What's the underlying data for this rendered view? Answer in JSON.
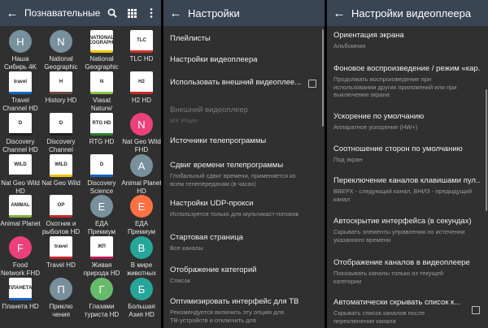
{
  "panel1": {
    "title": "Познавательные",
    "channels": [
      {
        "logo": "Н",
        "logo_type": "circle",
        "color": "#78909c",
        "name1": "Наша",
        "name2": "Сибирь 4K"
      },
      {
        "logo": "N",
        "logo_type": "circle",
        "color": "#78909c",
        "name1": "National",
        "name2": "Geographic"
      },
      {
        "logo": "NATIONAL GEOGRAPHIC",
        "logo_type": "square",
        "color": "#f2c500",
        "name1": "National",
        "name2": "Geographic"
      },
      {
        "logo": "TLC",
        "logo_type": "square",
        "color": "#d32f2f",
        "name1": "TLC HD",
        "name2": ""
      },
      {
        "logo": "travel",
        "logo_type": "square",
        "color": "#1565c0",
        "name1": "Travel",
        "name2": "Channel HD"
      },
      {
        "logo": "H",
        "logo_type": "square",
        "color": "#6d4c41",
        "name1": "History HD",
        "name2": ""
      },
      {
        "logo": "N",
        "logo_type": "square",
        "color": "#8bc34a",
        "name1": "Viasat",
        "name2": "Nature/"
      },
      {
        "logo": "H2",
        "logo_type": "square",
        "color": "#c62828",
        "name1": "H2 HD",
        "name2": ""
      },
      {
        "logo": "D",
        "logo_type": "square",
        "color": "#1e1e1e",
        "name1": "Discovery",
        "name2": "Channel HD"
      },
      {
        "logo": "D",
        "logo_type": "square",
        "color": "#1e1e1e",
        "name1": "Discovery",
        "name2": "Channel"
      },
      {
        "logo": "RTG HD",
        "logo_type": "square",
        "color": "#2e7d32",
        "name1": "RTG HD",
        "name2": ""
      },
      {
        "logo": "N",
        "logo_type": "circle",
        "color": "#ec407a",
        "name1": "Nat Geo Wild",
        "name2": "FHD"
      },
      {
        "logo": "WILD",
        "logo_type": "square",
        "color": "#333333",
        "name1": "Nat Geo Wild",
        "name2": "HD"
      },
      {
        "logo": "WILD",
        "logo_type": "square",
        "color": "#f2c500",
        "name1": "Nat Geo Wild",
        "name2": ""
      },
      {
        "logo": "D",
        "logo_type": "square",
        "color": "#1565c0",
        "name1": "Discovery",
        "name2": "Science"
      },
      {
        "logo": "A",
        "logo_type": "circle",
        "color": "#78909c",
        "name1": "Animal Planet",
        "name2": "HD"
      },
      {
        "logo": "ANIMAL",
        "logo_type": "square",
        "color": "#7cb342",
        "name1": "Animal Planet",
        "name2": ""
      },
      {
        "logo": "ОР",
        "logo_type": "square",
        "color": "#c62828",
        "name1": "Охотник и",
        "name2": "рыболов HD"
      },
      {
        "logo": "Е",
        "logo_type": "circle",
        "color": "#78909c",
        "name1": "ЕДА",
        "name2": "Премиум"
      },
      {
        "logo": "Е",
        "logo_type": "circle",
        "color": "#ff7043",
        "name1": "ЕДА",
        "name2": "Премиум"
      },
      {
        "logo": "F",
        "logo_type": "circle",
        "color": "#ec407a",
        "name1": "Food",
        "name2": "Network FHD"
      },
      {
        "logo": "travel",
        "logo_type": "square",
        "color": "#c62828",
        "name1": "Travel HD",
        "name2": ""
      },
      {
        "logo": "ЖП",
        "logo_type": "square",
        "color": "#c2185b",
        "name1": "Живая",
        "name2": "природа HD"
      },
      {
        "logo": "В",
        "logo_type": "circle",
        "color": "#26a69a",
        "name1": "В мире",
        "name2": "животных"
      },
      {
        "logo": "ПЛАНЕТА",
        "logo_type": "square",
        "color": "#1565c0",
        "name1": "Планета HD",
        "name2": ""
      },
      {
        "logo": "П",
        "logo_type": "circle",
        "color": "#78909c",
        "name1": "Приклю",
        "name2": "чения"
      },
      {
        "logo": "Г",
        "logo_type": "circle",
        "color": "#66bb6a",
        "name1": "Глазами",
        "name2": "туриста HD"
      },
      {
        "logo": "Б",
        "logo_type": "circle",
        "color": "#26a69a",
        "name1": "Большая",
        "name2": "Азия HD"
      }
    ]
  },
  "panel2": {
    "title": "Настройки",
    "items": [
      {
        "title": "Плейлисты",
        "sub": "",
        "checkbox": false,
        "disabled": false
      },
      {
        "title": "Настройки видеоплеера",
        "sub": "",
        "checkbox": false,
        "disabled": false
      },
      {
        "title": "Использовать внешний видеоплее...",
        "sub": "",
        "checkbox": true,
        "disabled": false
      },
      {
        "title": "Внешний видеоплеер",
        "sub": "MX Player",
        "checkbox": false,
        "disabled": true
      },
      {
        "title": "Источники телепрограммы",
        "sub": "",
        "checkbox": false,
        "disabled": false
      },
      {
        "title": "Сдвиг времени телепрограммы",
        "sub": "Глобальный сдвиг времени, применяется ко",
        "sub2": "всем телепередачам (в часах)",
        "checkbox": false,
        "disabled": false
      },
      {
        "title": "Настройки UDP-прокси",
        "sub": "Используется только для мультикаст-потоков",
        "checkbox": false,
        "disabled": false
      },
      {
        "title": "Стартовая страница",
        "sub": "Все каналы",
        "checkbox": false,
        "disabled": false
      },
      {
        "title": "Отображение категорий",
        "sub": "Список",
        "checkbox": false,
        "disabled": false
      },
      {
        "title": "Оптимизировать интерфейс для ТВ",
        "sub": "Рекомендуется включить эту опцию для",
        "sub2": "ТВ-устройств и отключить для",
        "checkbox": false,
        "disabled": false
      }
    ]
  },
  "panel3": {
    "title": "Настройки видеоплеера",
    "items": [
      {
        "title": "Ориентация экрана",
        "sub": "Альбомная",
        "checkbox": false
      },
      {
        "title": "Фоновое воспроизведение / режим «кар...",
        "sub": "Продолжать воспроизведение при",
        "sub2": "использовании других приложений или при",
        "sub3": "выключении экрана",
        "checkbox": false
      },
      {
        "title": "Ускорение по умолчанию",
        "sub": "Аппаратное ускорение (HW+)",
        "checkbox": false
      },
      {
        "title": "Соотношение сторон по умолчанию",
        "sub": "Под экран",
        "checkbox": false
      },
      {
        "title": "Переключение каналов клавишами пул...",
        "sub": "ВВЕРХ - следующий канал, ВНИЗ - предыдущий",
        "sub2": "канал",
        "checkbox": false
      },
      {
        "title": "Автоскрытие интерфейса (в секундах)",
        "sub": "Скрывать элементы управления по истечении",
        "sub2": "указанного времени",
        "checkbox": false
      },
      {
        "title": "Отображение каналов в видеоплеере",
        "sub": "Показывать каналы только из текущей",
        "sub2": "категории",
        "checkbox": false
      },
      {
        "title": "Автоматически скрывать список к...",
        "sub": "Скрывать список каналов после",
        "sub2": "переключения канала",
        "checkbox": true
      }
    ]
  },
  "icons": {
    "back": "arrow-left-icon",
    "search": "search-icon",
    "grid": "grid-view-icon",
    "menu": "more-vert-icon"
  },
  "colors": {
    "appbar": "#3a4554",
    "background": "#303030"
  }
}
